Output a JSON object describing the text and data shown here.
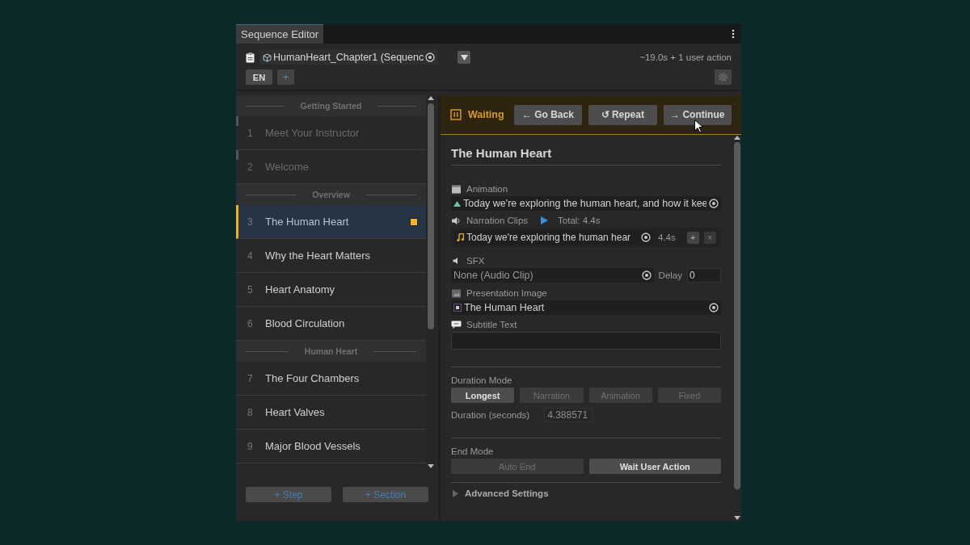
{
  "window": {
    "tab": "Sequence Editor"
  },
  "toolbar": {
    "asset": "HumanHeart_Chapter1 (Sequenc",
    "summary": "~19.0s + 1 user action",
    "language": "EN",
    "add_language": "+"
  },
  "steps_panel": {
    "items": [
      {
        "kind": "section",
        "label": "Getting Started"
      },
      {
        "kind": "step",
        "number": "1",
        "title": "Meet Your Instructor",
        "visited": true,
        "selected": false
      },
      {
        "kind": "step",
        "number": "2",
        "title": "Welcome",
        "visited": true,
        "selected": false
      },
      {
        "kind": "section",
        "label": "Overview"
      },
      {
        "kind": "step",
        "number": "3",
        "title": "The Human Heart",
        "visited": false,
        "selected": true
      },
      {
        "kind": "step",
        "number": "4",
        "title": "Why the Heart Matters",
        "visited": false,
        "selected": false
      },
      {
        "kind": "step",
        "number": "5",
        "title": "Heart Anatomy",
        "visited": false,
        "selected": false
      },
      {
        "kind": "step",
        "number": "6",
        "title": "Blood Circulation",
        "visited": false,
        "selected": false
      },
      {
        "kind": "section",
        "label": "Human Heart"
      },
      {
        "kind": "step",
        "number": "7",
        "title": "The Four Chambers",
        "visited": false,
        "selected": false
      },
      {
        "kind": "step",
        "number": "8",
        "title": "Heart Valves",
        "visited": false,
        "selected": false
      },
      {
        "kind": "step",
        "number": "9",
        "title": "Major Blood Vessels",
        "visited": false,
        "selected": false
      }
    ],
    "buttons": [
      "+ Step",
      "+ Section"
    ]
  },
  "playback": {
    "status": "Waiting",
    "buttons": [
      "← Go Back",
      "↺ Repeat",
      "→ Continue"
    ]
  },
  "inspector": {
    "title": "The Human Heart",
    "animation": {
      "label": "Animation",
      "value": "Today we're exploring the human heart, and how it kee"
    },
    "narration": {
      "label": "Narration Clips",
      "total": "Total: 4.4s",
      "clips": [
        {
          "value": "Today we're exploring the human hear",
          "duration": "4.4s",
          "add": "+",
          "remove": "×"
        }
      ]
    },
    "sfx": {
      "label": "SFX",
      "value": "None (Audio Clip)",
      "delay_label": "Delay",
      "delay": "0"
    },
    "image": {
      "label": "Presentation Image",
      "value": "The Human Heart"
    },
    "subtitle": {
      "label": "Subtitle Text"
    },
    "duration_mode": {
      "label": "Duration Mode",
      "options": [
        {
          "label": "Longest",
          "selected": true
        },
        {
          "label": "Narration",
          "selected": false
        },
        {
          "label": "Animation",
          "selected": false
        },
        {
          "label": "Fixed",
          "selected": false
        }
      ]
    },
    "duration": {
      "label": "Duration (seconds)",
      "value": "4.388571"
    },
    "end_mode": {
      "label": "End Mode",
      "options": [
        {
          "label": "Auto End",
          "selected": false
        },
        {
          "label": "Wait User Action",
          "selected": true
        }
      ]
    },
    "advanced": {
      "label": "Advanced Settings",
      "expanded": false
    }
  }
}
